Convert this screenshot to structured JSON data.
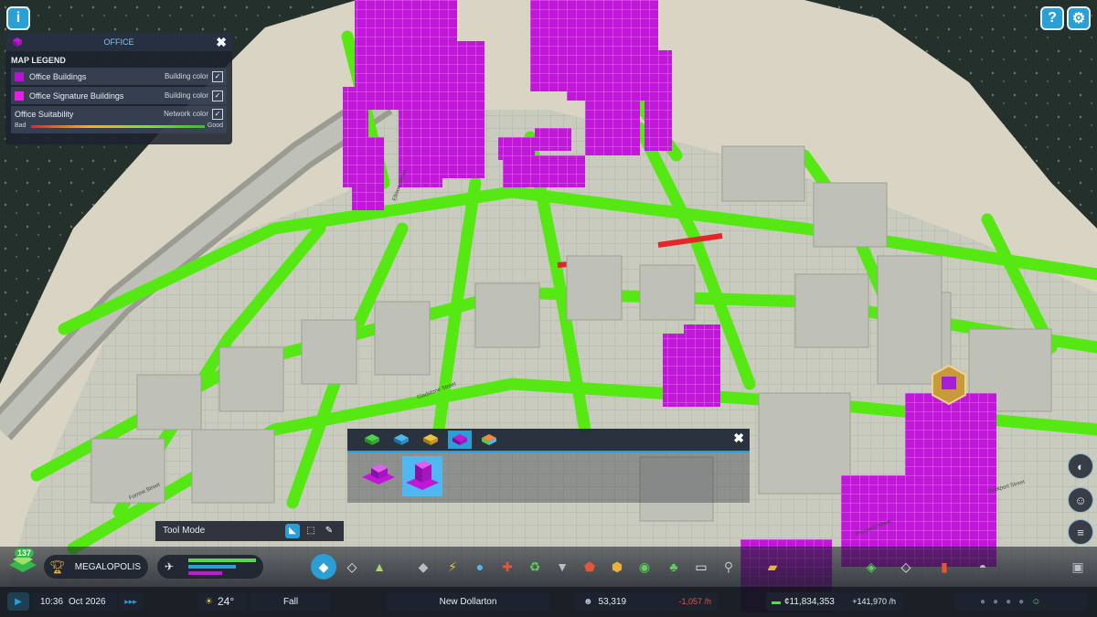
{
  "top_buttons": {
    "info_icon": "i",
    "help_icon": "?",
    "settings_icon": "⚙"
  },
  "legend": {
    "title": "OFFICE",
    "close": "✖",
    "section": "MAP LEGEND",
    "items": [
      {
        "label": "Office Buildings",
        "mode": "Building color",
        "checked": "✓",
        "color": "#b514d6"
      },
      {
        "label": "Office Signature Buildings",
        "mode": "Building color",
        "checked": "✓",
        "color": "#e11fe6"
      }
    ],
    "suitability": {
      "label": "Office Suitability",
      "mode": "Network color",
      "checked": "✓",
      "bad": "Bad",
      "good": "Good"
    }
  },
  "tool_panel": {
    "close": "✖",
    "tabs": [
      "zone-residential",
      "zone-commercial",
      "zone-industrial",
      "zone-office",
      "zone-mixed"
    ],
    "selected_tab": 3
  },
  "tool_mode": {
    "label": "Tool Mode"
  },
  "status": {
    "milestone_level": "137",
    "milestone_name": "MEGALOPOLIS",
    "time": "10:36",
    "date": "Oct 2026",
    "temperature": "24°",
    "season": "Fall",
    "city_name": "New Dollarton",
    "population": "53,319",
    "population_change": "-1,057 /h",
    "money": "¢11,834,353",
    "money_change": "+141,970 /h"
  },
  "street_labels": [
    "Ellison Street",
    "Gladstone Street",
    "Forrest Street",
    "Prospect Street",
    "Rockport Street"
  ],
  "colors": {
    "accent": "#2a9fd6",
    "office": "#e11fe6",
    "good": "#7ee21f",
    "bad": "#e12727"
  }
}
